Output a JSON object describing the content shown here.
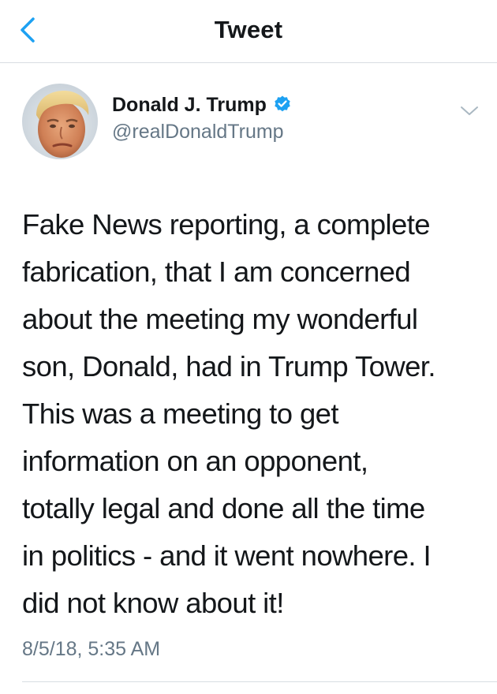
{
  "nav": {
    "title": "Tweet",
    "back_icon": "chevron-left-icon"
  },
  "tweet": {
    "author": {
      "display_name": "Donald J. Trump",
      "handle": "@realDonaldTrump",
      "verified": true
    },
    "text_lines": [
      "Fake News reporting, a complete",
      "fabrication, that I am concerned",
      "about the meeting my wonderful",
      "son, Donald, had in Trump Tower.",
      "This was a meeting to get",
      "information on an opponent,",
      "totally legal and done all the time",
      "in politics - and it went nowhere. I",
      "did not know about it!"
    ],
    "timestamp": "8/5/18, 5:35 AM"
  },
  "colors": {
    "accent": "#1da1f2",
    "text_primary": "#14171a",
    "text_secondary": "#657786",
    "divider": "#d8dde2"
  }
}
